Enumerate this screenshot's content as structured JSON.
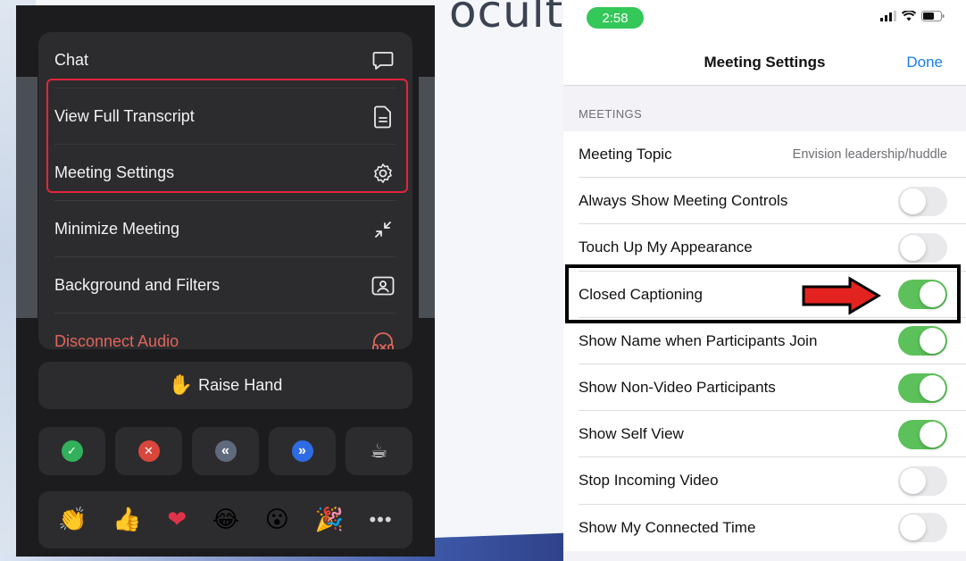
{
  "background": {
    "word": "ocultc"
  },
  "left_panel": {
    "menu": [
      {
        "label": "Chat",
        "icon": "chat-bubble-icon"
      },
      {
        "label": "View Full Transcript",
        "icon": "document-icon"
      },
      {
        "label": "Meeting Settings",
        "icon": "gear-icon"
      },
      {
        "label": "Minimize Meeting",
        "icon": "minimize-icon"
      },
      {
        "label": "Background and Filters",
        "icon": "portrait-frame-icon"
      },
      {
        "label": "Disconnect Audio",
        "icon": "headphones-x-icon",
        "danger": true
      }
    ],
    "raise_hand": {
      "label": "Raise Hand",
      "emoji": "✋"
    },
    "feedback": [
      {
        "name": "yes",
        "glyph": "✓",
        "color": "#31b15b"
      },
      {
        "name": "no",
        "glyph": "✕",
        "color": "#d9463b"
      },
      {
        "name": "slower",
        "glyph": "«",
        "color": "#5f6a7d"
      },
      {
        "name": "faster",
        "glyph": "»",
        "color": "#2f6be2"
      },
      {
        "name": "coffee",
        "glyph": "☕",
        "color": "transparent"
      }
    ],
    "reactions": [
      "👏",
      "👍",
      "❤",
      "😂",
      "😮",
      "🎉",
      "•••"
    ],
    "highlight_color": "#e4253a"
  },
  "right_panel": {
    "status": {
      "time": "2:58"
    },
    "nav": {
      "title": "Meeting Settings",
      "done_label": "Done"
    },
    "section_header": "MEETINGS",
    "rows": [
      {
        "label": "Meeting Topic",
        "value": "Envision leadership/huddle"
      },
      {
        "label": "Always Show Meeting Controls",
        "toggle": false
      },
      {
        "label": "Touch Up My Appearance",
        "toggle": false
      },
      {
        "label": "Closed Captioning",
        "toggle": true
      },
      {
        "label": "Show Name when Participants Join",
        "toggle": true
      },
      {
        "label": "Show Non-Video Participants",
        "toggle": true
      },
      {
        "label": "Show Self View",
        "toggle": true
      },
      {
        "label": "Stop Incoming Video",
        "toggle": false
      },
      {
        "label": "Show My Connected Time",
        "toggle": false
      }
    ],
    "accent_color": "#1a7cf5",
    "toggle_on_color": "#5cc15a"
  }
}
